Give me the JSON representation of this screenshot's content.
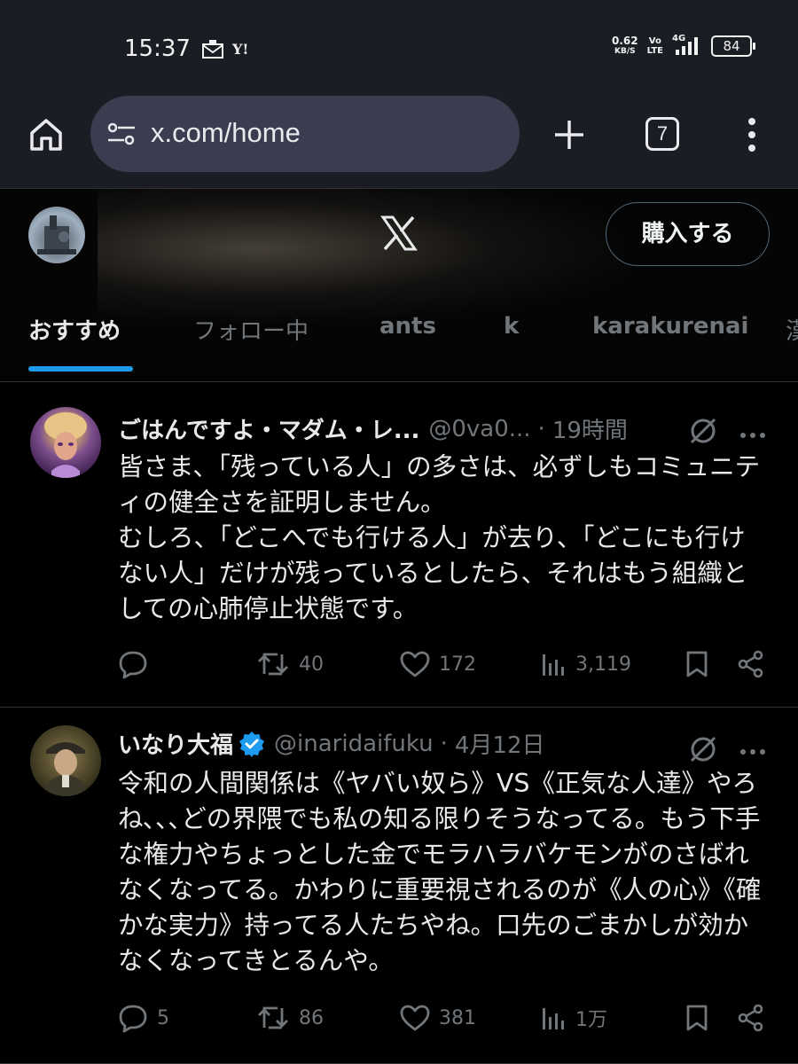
{
  "status_bar": {
    "time": "15:37",
    "notif_icons": [
      "mail-icon",
      "yahoo-icon"
    ],
    "speed_top": "0.62",
    "speed_bottom": "KB/S",
    "volte_top": "Vo",
    "volte_bottom": "LTE",
    "network": "4G",
    "battery": "84"
  },
  "browser": {
    "url": "x.com/home",
    "tab_count": "7"
  },
  "x_header": {
    "buy_label": "購入する",
    "tabs": [
      "おすすめ",
      "フォロー中",
      "ants",
      "k",
      "karakurenai",
      "漢"
    ],
    "active_tab": 0
  },
  "tweets": [
    {
      "name": "ごはんですよ・マダム・レ...",
      "handle": "@0va0...",
      "time": "19時間",
      "verified": false,
      "body": "皆さま、「残っている人」の多さは、必ずしもコミュニティの健全さを証明しません。\nむしろ、「どこへでも行ける人」が去り、「どこにも行けない人」だけが残っているとしたら、それはもう組織としての心肺停止状態です。",
      "replies": "",
      "reposts": "40",
      "likes": "172",
      "views": "3,119"
    },
    {
      "name": "いなり大福",
      "handle": "@inaridaifuku",
      "time": "4月12日",
      "verified": true,
      "body": "令和の人間関係は《ヤバい奴ら》VS《正気な人達》やろね､､､どの界隈でも私の知る限りそうなってる。もう下手な権力やちょっとした金でモラハラバケモンがのさばれなくなってる。かわりに重要視されるのが《人の心》《確かな実力》持ってる人たちやね。口先のごまかしが効かなくなってきとるんや。",
      "replies": "5",
      "reposts": "86",
      "likes": "381",
      "views": "1万"
    }
  ],
  "colors": {
    "accent": "#1d9bf0",
    "muted": "#71767b",
    "text": "#e7e9ea",
    "browser_bg": "#1b1d24",
    "url_bg": "#3a3d4f"
  }
}
